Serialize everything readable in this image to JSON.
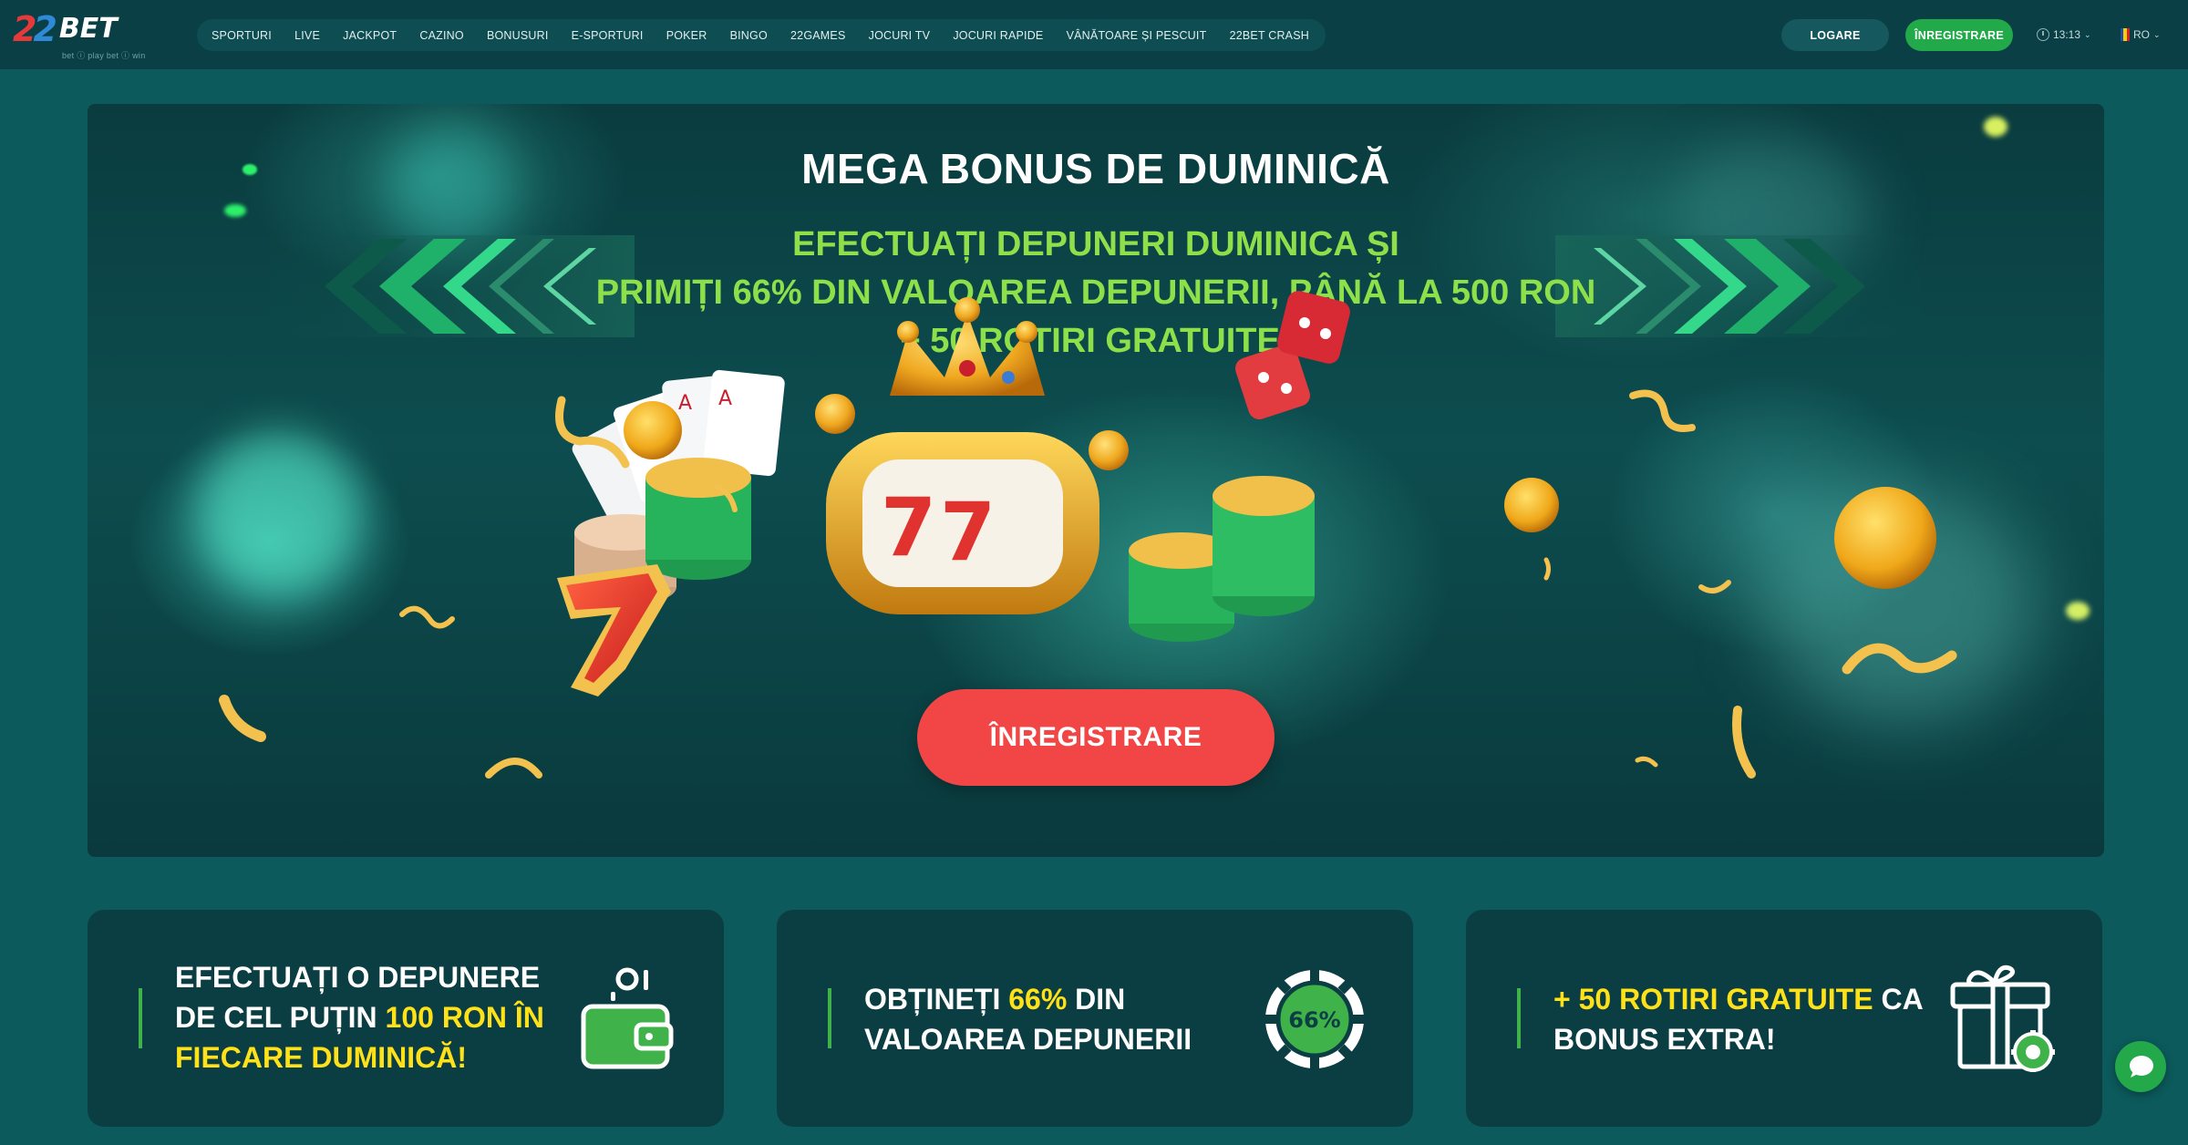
{
  "logo": {
    "digits": "22",
    "word": "BET",
    "tagline": "bet ⓘ play  bet ⓘ win"
  },
  "nav": {
    "items": [
      "SPORTURI",
      "LIVE",
      "JACKPOT",
      "CAZINO",
      "BONUSURI",
      "E-SPORTURI",
      "POKER",
      "BINGO",
      "22GAMES",
      "JOCURI TV",
      "JOCURI RAPIDE",
      "VÂNĂTOARE ȘI PESCUIT",
      "22BET CRASH"
    ]
  },
  "header": {
    "login_label": "LOGARE",
    "register_label": "ÎNREGISTRARE",
    "time": "13:13",
    "language": "RO"
  },
  "hero": {
    "title": "MEGA BONUS DE DUMINICĂ",
    "subtitle_lines": [
      "EFECTUAȚI DEPUNERI DUMINICA ȘI",
      "PRIMIȚI 66% DIN VALOAREA DEPUNERII, PÂNĂ LA 500 RON",
      "+ 50 ROTIRI GRATUITE!"
    ],
    "cta_label": "ÎNREGISTRARE"
  },
  "cards": [
    {
      "lines": [
        [
          {
            "t": "EFECTUAȚI O DEPUNERE",
            "hl": false
          }
        ],
        [
          {
            "t": "DE CEL PUȚIN ",
            "hl": false
          },
          {
            "t": "100 RON ÎN",
            "hl": true
          }
        ],
        [
          {
            "t": "FIECARE DUMINICĂ!",
            "hl": true
          }
        ]
      ],
      "icon": "wallet-icon"
    },
    {
      "lines": [
        [
          {
            "t": "OBȚINEȚI ",
            "hl": false
          },
          {
            "t": "66%",
            "hl": true
          },
          {
            "t": " DIN",
            "hl": false
          }
        ],
        [
          {
            "t": "VALOAREA DEPUNERII",
            "hl": false
          }
        ]
      ],
      "icon": "chip-icon",
      "chip_label": "66%"
    },
    {
      "lines": [
        [
          {
            "t": "+ 50 ROTIRI GRATUITE",
            "hl": true
          },
          {
            "t": " CA",
            "hl": false
          }
        ],
        [
          {
            "t": "BONUS EXTRA!",
            "hl": false
          }
        ]
      ],
      "icon": "gift-icon"
    }
  ],
  "colors": {
    "page_bg": "#0c5a5c",
    "topbar_bg": "#0a3f45",
    "accent_green": "#22a94a",
    "cta_red": "#f24545",
    "subtitle_green": "#8ee04a",
    "highlight_yellow": "#ffe11a"
  },
  "chat": {
    "icon": "chat-bubble-icon"
  }
}
